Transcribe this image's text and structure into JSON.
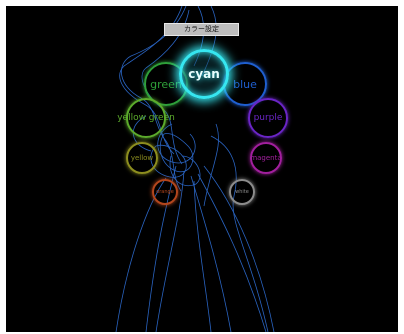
{
  "header": {
    "title": "カラー設定"
  },
  "colors": {
    "selected": "cyan",
    "items": [
      {
        "label": "cyan",
        "color": "#36e6f0"
      },
      {
        "label": "green",
        "color": "#2fa03a"
      },
      {
        "label": "blue",
        "color": "#1f5fd0"
      },
      {
        "label": "yellow green",
        "color": "#5cab2c"
      },
      {
        "label": "purple",
        "color": "#6a25c6"
      },
      {
        "label": "yellow",
        "color": "#8d8e1f"
      },
      {
        "label": "magenta",
        "color": "#a21f9e"
      },
      {
        "label": "orange",
        "color": "#b3461d"
      },
      {
        "label": "white",
        "color": "#8c8c8c"
      }
    ]
  }
}
